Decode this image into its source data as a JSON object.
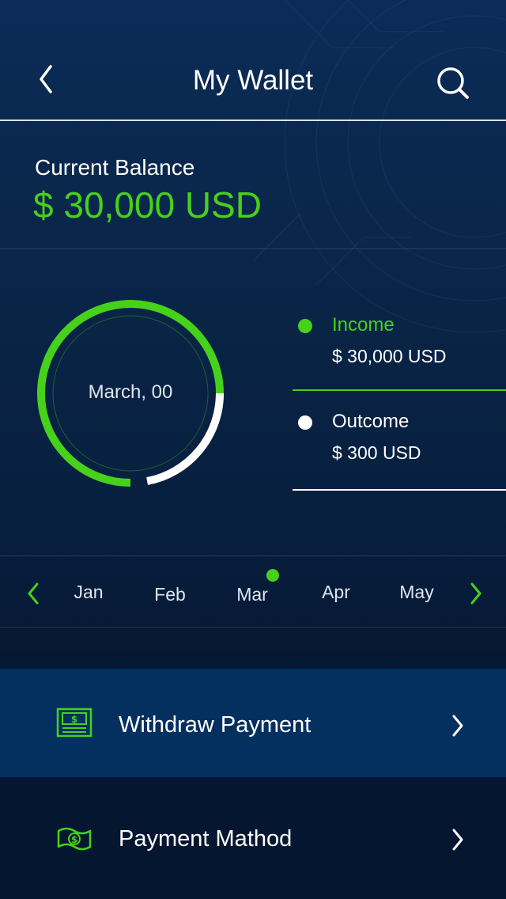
{
  "header": {
    "title": "My Wallet",
    "back_icon": "chevron-left-icon",
    "search_icon": "search-icon"
  },
  "balance": {
    "label": "Current Balance",
    "value": "$ 30,000 USD"
  },
  "chart_data": {
    "type": "pie",
    "categories": [
      "Income",
      "Outcome"
    ],
    "values": [
      30000,
      300
    ],
    "center_label": "March, 00",
    "colors": {
      "income": "#46d11b",
      "outcome": "#ffffff"
    }
  },
  "legend": {
    "income": {
      "label": "Income",
      "value": "$ 30,000 USD"
    },
    "outcome": {
      "label": "Outcome",
      "value": "$ 300 USD"
    }
  },
  "months": {
    "items": [
      "Jan",
      "Feb",
      "Mar",
      "Apr",
      "May"
    ],
    "selected": "Mar",
    "prev_icon": "chevron-left-icon",
    "next_icon": "chevron-right-icon"
  },
  "menu": {
    "withdraw": {
      "label": "Withdraw Payment",
      "icon": "cash-register-icon"
    },
    "method": {
      "label": "Payment Mathod",
      "icon": "money-bill-icon"
    }
  },
  "colors": {
    "accent": "#46d11b",
    "background": "#0a2548",
    "highlight_row": "#04305f"
  }
}
